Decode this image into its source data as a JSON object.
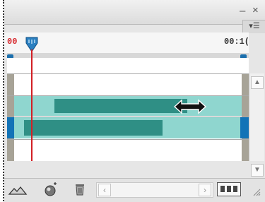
{
  "window": {
    "minimize_label": "–",
    "close_label": "×",
    "menu_label": "▾☰"
  },
  "timeline": {
    "start_time": "00",
    "end_time": "00:1("
  },
  "scrollbar": {
    "up_arrow": "▲",
    "down_arrow": "▼"
  },
  "bottom_toolbar": {
    "left_arrow": "‹",
    "right_arrow": "›"
  },
  "colors": {
    "clip_light": "#8fd6cf",
    "clip_dark": "#2f8f85",
    "playhead": "#d31f25",
    "selection_blue": "#1273b7"
  },
  "icons": {
    "resize_cursor": "left-right-arrow-icon",
    "playhead": "playhead-marker-icon",
    "zoom": "mountain-zoom-icon",
    "render": "tween-ball-icon",
    "delete": "trash-icon",
    "convert": "frames-icon"
  }
}
